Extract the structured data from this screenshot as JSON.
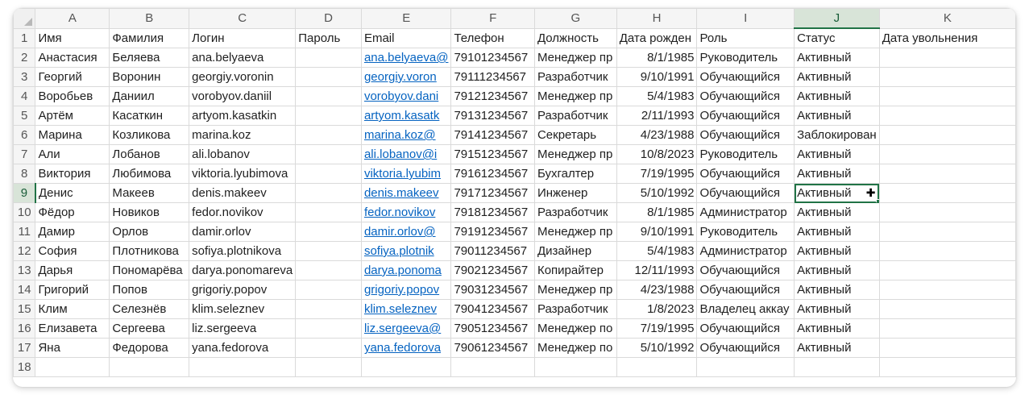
{
  "columns": [
    "A",
    "B",
    "C",
    "D",
    "E",
    "F",
    "G",
    "H",
    "I",
    "J",
    "K"
  ],
  "selected_column": "J",
  "selected_row": "9",
  "rows": [
    {
      "n": "1",
      "cells": [
        "Имя",
        "Фамилия",
        "Логин",
        "Пароль",
        "Email",
        "Телефон",
        "Должность",
        "Дата рожден",
        "Роль",
        "Статус",
        "Дата увольнения"
      ]
    },
    {
      "n": "2",
      "cells": [
        "Анастасия",
        "Беляева",
        "ana.belyaeva",
        "",
        "ana.belyaeva@",
        "79101234567",
        "Менеджер пр",
        "8/1/1985",
        "Руководитель",
        "Активный",
        ""
      ]
    },
    {
      "n": "3",
      "cells": [
        "Георгий",
        "Воронин",
        "georgiy.voronin",
        "",
        "georgiy.voron",
        "79111234567",
        "Разработчик",
        "9/10/1991",
        "Обучающийся",
        "Активный",
        ""
      ]
    },
    {
      "n": "4",
      "cells": [
        "Воробьев",
        "Даниил",
        "vorobyov.daniil",
        "",
        "vorobyov.dani",
        "79121234567",
        "Менеджер пр",
        "5/4/1983",
        "Обучающийся",
        "Активный",
        ""
      ]
    },
    {
      "n": "5",
      "cells": [
        "Артём",
        "Касаткин",
        "artyom.kasatkin",
        "",
        "artyom.kasatk",
        "79131234567",
        "Разработчик",
        "2/11/1993",
        "Обучающийся",
        "Активный",
        ""
      ]
    },
    {
      "n": "6",
      "cells": [
        "Марина",
        "Козликова",
        "marina.koz",
        "",
        "marina.koz@",
        "79141234567",
        "Секретарь",
        "4/23/1988",
        "Обучающийся",
        "Заблокирован",
        ""
      ]
    },
    {
      "n": "7",
      "cells": [
        "Али",
        "Лобанов",
        "ali.lobanov",
        "",
        "ali.lobanov@i",
        "79151234567",
        "Менеджер пр",
        "10/8/2023",
        "Руководитель",
        "Активный",
        ""
      ]
    },
    {
      "n": "8",
      "cells": [
        "Виктория",
        "Любимова",
        "viktoria.lyubimova",
        "",
        "viktoria.lyubim",
        "79161234567",
        "Бухгалтер",
        "7/19/1995",
        "Обучающийся",
        "Активный",
        ""
      ]
    },
    {
      "n": "9",
      "cells": [
        "Денис",
        "Макеев",
        "denis.makeev",
        "",
        "denis.makeev",
        "79171234567",
        "Инженер",
        "5/10/1992",
        "Обучающийся",
        "Активный",
        ""
      ]
    },
    {
      "n": "10",
      "cells": [
        "Фёдор",
        "Новиков",
        "fedor.novikov",
        "",
        "fedor.novikov",
        "79181234567",
        "Разработчик",
        "8/1/1985",
        "Администратор",
        "Активный",
        ""
      ]
    },
    {
      "n": "11",
      "cells": [
        "Дамир",
        "Орлов",
        "damir.orlov",
        "",
        "damir.orlov@",
        "79191234567",
        "Менеджер пр",
        "9/10/1991",
        "Руководитель",
        "Активный",
        ""
      ]
    },
    {
      "n": "12",
      "cells": [
        "София",
        "Плотникова",
        "sofiya.plotnikova",
        "",
        "sofiya.plotnik",
        "79011234567",
        "Дизайнер",
        "5/4/1983",
        "Администратор",
        "Активный",
        ""
      ]
    },
    {
      "n": "13",
      "cells": [
        "Дарья",
        "Пономарёва",
        "darya.ponomareva",
        "",
        "darya.ponoma",
        "79021234567",
        "Копирайтер",
        "12/11/1993",
        "Обучающийся",
        "Активный",
        ""
      ]
    },
    {
      "n": "14",
      "cells": [
        "Григорий",
        "Попов",
        "grigoriy.popov",
        "",
        "grigoriy.popov",
        "79031234567",
        "Менеджер пр",
        "4/23/1988",
        "Обучающийся",
        "Активный",
        ""
      ]
    },
    {
      "n": "15",
      "cells": [
        "Клим",
        "Селезнёв",
        "klim.seleznev",
        "",
        "klim.seleznev",
        "79041234567",
        "Разработчик",
        "1/8/2023",
        "Владелец аккау",
        "Активный",
        ""
      ]
    },
    {
      "n": "16",
      "cells": [
        "Елизавета",
        "Сергеева",
        "liz.sergeeva",
        "",
        "liz.sergeeva@",
        "79051234567",
        "Менеджер по",
        "7/19/1995",
        "Обучающийся",
        "Активный",
        ""
      ]
    },
    {
      "n": "17",
      "cells": [
        "Яна",
        "Федорова",
        "yana.fedorova",
        "",
        "yana.fedorova",
        "79061234567",
        "Менеджер по",
        "5/10/1992",
        "Обучающийся",
        "Активный",
        ""
      ]
    },
    {
      "n": "18",
      "cells": [
        "",
        "",
        "",
        "",
        "",
        "",
        "",
        "",
        "",
        "",
        ""
      ]
    }
  ],
  "active_cell": {
    "row": "9",
    "col": "J"
  },
  "accent_color": "#217346",
  "link_color": "#0563c1",
  "cursor_icon": "cell-select-cursor-icon"
}
